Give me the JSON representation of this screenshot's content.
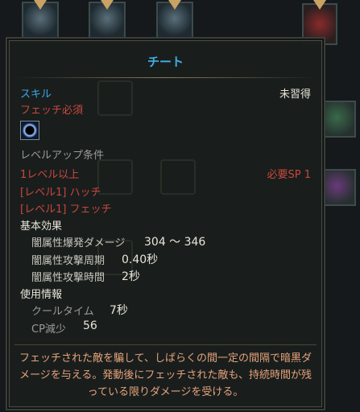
{
  "tooltip": {
    "title": "チート",
    "category": "スキル",
    "status": "未習得",
    "requirement": "フェッチ必須",
    "skill_icon": "dark-ring-icon",
    "levelup_header": "レベルアップ条件",
    "level_req": "1レベル以上",
    "sp_req": "必要SP 1",
    "prereqs": [
      "[レベル1] ハッチ",
      "[レベル1] フェッチ"
    ],
    "base_effect_header": "基本効果",
    "effects": [
      {
        "label": "闇属性爆発ダメージ",
        "value": "304 ～ 346"
      },
      {
        "label": "闇属性攻撃周期",
        "value": "0.40秒"
      },
      {
        "label": "闇属性攻撃時間",
        "value": "2秒"
      }
    ],
    "usage_header": "使用情報",
    "usage": [
      {
        "label": "クールタイム",
        "value": "7秒"
      },
      {
        "label": "CP減少",
        "value": "56"
      }
    ],
    "description": "フェッチされた敵を騙して、しばらくの間一定の間隔で暗黒ダメージを与える。発動後にフェッチされた敵も、持続時間が残っている限りダメージを受ける。"
  },
  "colors": {
    "title": "#3fb0e8",
    "requirement": "#c9473c",
    "description": "#e6a27b"
  }
}
